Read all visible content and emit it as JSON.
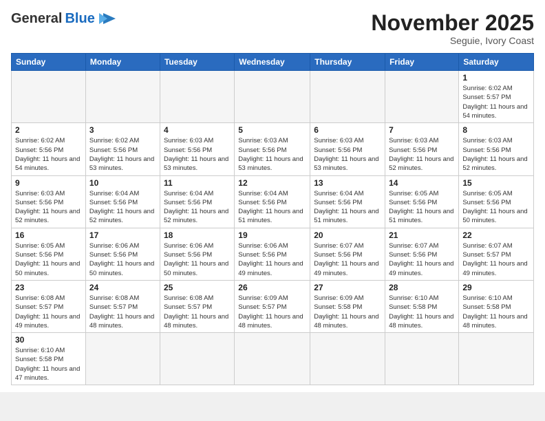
{
  "header": {
    "logo_general": "General",
    "logo_blue": "Blue",
    "month_title": "November 2025",
    "location": "Seguie, Ivory Coast"
  },
  "weekdays": [
    "Sunday",
    "Monday",
    "Tuesday",
    "Wednesday",
    "Thursday",
    "Friday",
    "Saturday"
  ],
  "weeks": [
    [
      {
        "day": "",
        "info": ""
      },
      {
        "day": "",
        "info": ""
      },
      {
        "day": "",
        "info": ""
      },
      {
        "day": "",
        "info": ""
      },
      {
        "day": "",
        "info": ""
      },
      {
        "day": "",
        "info": ""
      },
      {
        "day": "1",
        "info": "Sunrise: 6:02 AM\nSunset: 5:57 PM\nDaylight: 11 hours and 54 minutes."
      }
    ],
    [
      {
        "day": "2",
        "info": "Sunrise: 6:02 AM\nSunset: 5:56 PM\nDaylight: 11 hours and 54 minutes."
      },
      {
        "day": "3",
        "info": "Sunrise: 6:02 AM\nSunset: 5:56 PM\nDaylight: 11 hours and 53 minutes."
      },
      {
        "day": "4",
        "info": "Sunrise: 6:03 AM\nSunset: 5:56 PM\nDaylight: 11 hours and 53 minutes."
      },
      {
        "day": "5",
        "info": "Sunrise: 6:03 AM\nSunset: 5:56 PM\nDaylight: 11 hours and 53 minutes."
      },
      {
        "day": "6",
        "info": "Sunrise: 6:03 AM\nSunset: 5:56 PM\nDaylight: 11 hours and 53 minutes."
      },
      {
        "day": "7",
        "info": "Sunrise: 6:03 AM\nSunset: 5:56 PM\nDaylight: 11 hours and 52 minutes."
      },
      {
        "day": "8",
        "info": "Sunrise: 6:03 AM\nSunset: 5:56 PM\nDaylight: 11 hours and 52 minutes."
      }
    ],
    [
      {
        "day": "9",
        "info": "Sunrise: 6:03 AM\nSunset: 5:56 PM\nDaylight: 11 hours and 52 minutes."
      },
      {
        "day": "10",
        "info": "Sunrise: 6:04 AM\nSunset: 5:56 PM\nDaylight: 11 hours and 52 minutes."
      },
      {
        "day": "11",
        "info": "Sunrise: 6:04 AM\nSunset: 5:56 PM\nDaylight: 11 hours and 52 minutes."
      },
      {
        "day": "12",
        "info": "Sunrise: 6:04 AM\nSunset: 5:56 PM\nDaylight: 11 hours and 51 minutes."
      },
      {
        "day": "13",
        "info": "Sunrise: 6:04 AM\nSunset: 5:56 PM\nDaylight: 11 hours and 51 minutes."
      },
      {
        "day": "14",
        "info": "Sunrise: 6:05 AM\nSunset: 5:56 PM\nDaylight: 11 hours and 51 minutes."
      },
      {
        "day": "15",
        "info": "Sunrise: 6:05 AM\nSunset: 5:56 PM\nDaylight: 11 hours and 50 minutes."
      }
    ],
    [
      {
        "day": "16",
        "info": "Sunrise: 6:05 AM\nSunset: 5:56 PM\nDaylight: 11 hours and 50 minutes."
      },
      {
        "day": "17",
        "info": "Sunrise: 6:06 AM\nSunset: 5:56 PM\nDaylight: 11 hours and 50 minutes."
      },
      {
        "day": "18",
        "info": "Sunrise: 6:06 AM\nSunset: 5:56 PM\nDaylight: 11 hours and 50 minutes."
      },
      {
        "day": "19",
        "info": "Sunrise: 6:06 AM\nSunset: 5:56 PM\nDaylight: 11 hours and 49 minutes."
      },
      {
        "day": "20",
        "info": "Sunrise: 6:07 AM\nSunset: 5:56 PM\nDaylight: 11 hours and 49 minutes."
      },
      {
        "day": "21",
        "info": "Sunrise: 6:07 AM\nSunset: 5:56 PM\nDaylight: 11 hours and 49 minutes."
      },
      {
        "day": "22",
        "info": "Sunrise: 6:07 AM\nSunset: 5:57 PM\nDaylight: 11 hours and 49 minutes."
      }
    ],
    [
      {
        "day": "23",
        "info": "Sunrise: 6:08 AM\nSunset: 5:57 PM\nDaylight: 11 hours and 49 minutes."
      },
      {
        "day": "24",
        "info": "Sunrise: 6:08 AM\nSunset: 5:57 PM\nDaylight: 11 hours and 48 minutes."
      },
      {
        "day": "25",
        "info": "Sunrise: 6:08 AM\nSunset: 5:57 PM\nDaylight: 11 hours and 48 minutes."
      },
      {
        "day": "26",
        "info": "Sunrise: 6:09 AM\nSunset: 5:57 PM\nDaylight: 11 hours and 48 minutes."
      },
      {
        "day": "27",
        "info": "Sunrise: 6:09 AM\nSunset: 5:58 PM\nDaylight: 11 hours and 48 minutes."
      },
      {
        "day": "28",
        "info": "Sunrise: 6:10 AM\nSunset: 5:58 PM\nDaylight: 11 hours and 48 minutes."
      },
      {
        "day": "29",
        "info": "Sunrise: 6:10 AM\nSunset: 5:58 PM\nDaylight: 11 hours and 48 minutes."
      }
    ],
    [
      {
        "day": "30",
        "info": "Sunrise: 6:10 AM\nSunset: 5:58 PM\nDaylight: 11 hours and 47 minutes."
      },
      {
        "day": "",
        "info": ""
      },
      {
        "day": "",
        "info": ""
      },
      {
        "day": "",
        "info": ""
      },
      {
        "day": "",
        "info": ""
      },
      {
        "day": "",
        "info": ""
      },
      {
        "day": "",
        "info": ""
      }
    ]
  ]
}
